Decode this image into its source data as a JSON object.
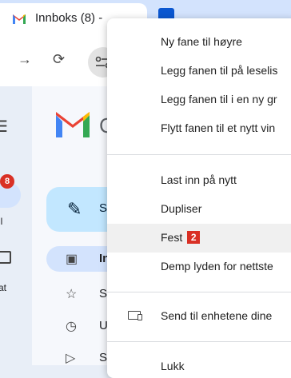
{
  "browser": {
    "tab_title": "Innboks (8) -",
    "colors": {
      "tabstrip": "#d3e3fd",
      "accent": "#0b57d0"
    }
  },
  "toolbar": {
    "forward_icon": "arrow-right-icon",
    "reload_icon": "reload-icon",
    "site_info_icon": "tune-icon"
  },
  "gmail": {
    "rail": {
      "badge_count": "8",
      "mail_label": "il",
      "chat_label": "at"
    },
    "compose_label": "S",
    "sidebar": [
      {
        "icon": "inbox-icon",
        "label": "In"
      },
      {
        "icon": "star-icon",
        "label": "S"
      },
      {
        "icon": "clock-icon",
        "label": "U"
      },
      {
        "icon": "send-icon",
        "label": "S"
      }
    ],
    "partial_letter": "C"
  },
  "context_menu": {
    "groups": [
      [
        "Ny fane til høyre",
        "Legg fanen til på leselis",
        "Legg fanen til i en ny gr",
        "Flytt fanen til et nytt vin"
      ],
      [
        "Last inn på nytt",
        "Dupliser",
        "Fest",
        "Demp lyden for nettste"
      ],
      [
        "Send til enhetene dine"
      ],
      [
        "Lukk"
      ]
    ],
    "highlighted_item": "Fest",
    "highlight_badge": "2",
    "send_icon": "devices-icon"
  }
}
